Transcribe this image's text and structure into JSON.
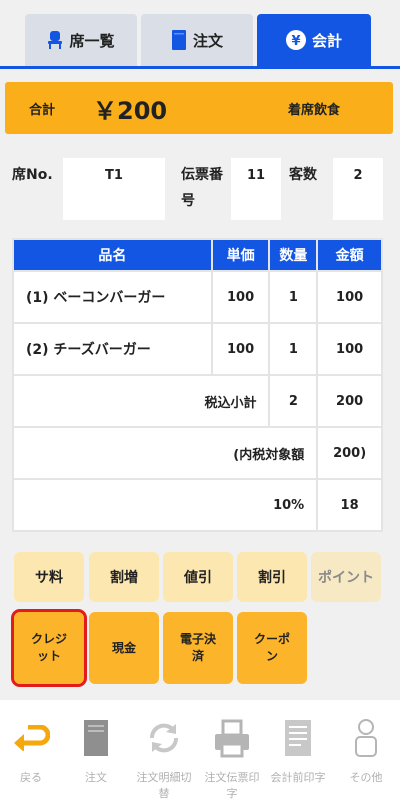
{
  "tabs": {
    "seats": "席一覧",
    "order": "注文",
    "pay": "会計"
  },
  "total": {
    "label": "合計",
    "amount": "￥200",
    "type": "着席飲食"
  },
  "info": {
    "seat_label": "席No.",
    "seat_value": "T1",
    "slip_label_1": "伝票番",
    "slip_label_2": "号",
    "slip_value": "11",
    "guests_label": "客数",
    "guests_value": "2"
  },
  "table": {
    "headers": [
      "品名",
      "単価",
      "数量",
      "金額"
    ],
    "rows": [
      {
        "name": "(1) ベーコンバーガー",
        "price": "100",
        "qty": "1",
        "amount": "100"
      },
      {
        "name": "(2) チーズバーガー",
        "price": "100",
        "qty": "1",
        "amount": "100"
      }
    ],
    "subtotal": {
      "label": "税込小計",
      "qty": "2",
      "amount": "200"
    },
    "taxable": {
      "label": "(内税対象額",
      "amount": "200)"
    },
    "tax": {
      "label": "10%",
      "amount": "18"
    }
  },
  "adjust_buttons": [
    "サ料",
    "割増",
    "値引",
    "割引",
    "ポイント"
  ],
  "pay_buttons": {
    "credit_1": "クレジ",
    "credit_2": "ット",
    "cash": "現金",
    "emoney_1": "電子決",
    "emoney_2": "済",
    "coupon_1": "クーポ",
    "coupon_2": "ン"
  },
  "footer": {
    "back": "戻る",
    "order": "注文",
    "detail_1": "注文明細切",
    "detail_2": "替",
    "slip_print_1": "注文伝票印",
    "slip_print_2": "字",
    "pre_print": "会計前印字",
    "other": "その他"
  },
  "colors": {
    "primary": "#1356e3",
    "accent": "#f9ae1a",
    "highlight": "#e21b1b"
  }
}
